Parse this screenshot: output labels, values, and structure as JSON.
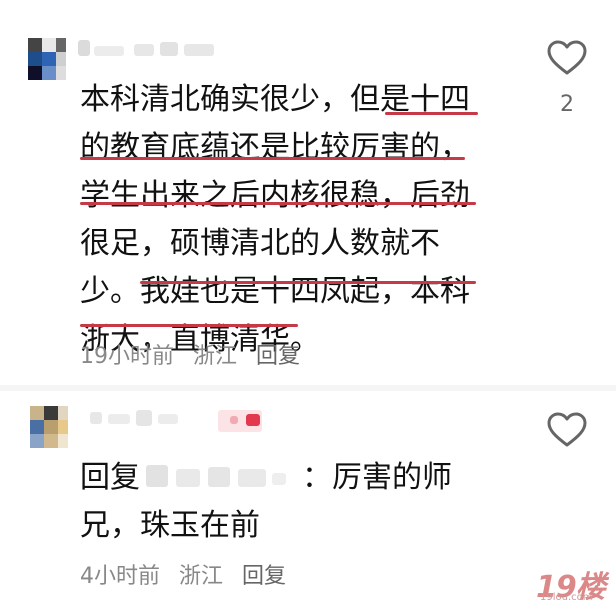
{
  "comments": [
    {
      "lines": [
        "本科清北确实很少，但是十四",
        "的教育底蕴还是比较厉害的，",
        "学生出来之后内核很稳，后劲",
        "很足，硕博清北的人数就不",
        "少。我娃也是十四凤起，本科",
        "浙大，直博清华。"
      ],
      "time": "19小时前",
      "location": "浙江",
      "reply_label": "回复",
      "like_count": "2"
    },
    {
      "line1_prefix": "回复",
      "line1_suffix": "：厉害的师",
      "line2": "兄，珠玉在前",
      "time": "4小时前",
      "location": "浙江",
      "reply_label": "回复"
    }
  ],
  "watermark": {
    "big": "19楼",
    "small": "19lou.com"
  },
  "colors": {
    "underline": "#c63a47",
    "meta_text": "#888888",
    "like_icon": "#666666"
  },
  "icons": {
    "like": "heart-outline-icon"
  }
}
